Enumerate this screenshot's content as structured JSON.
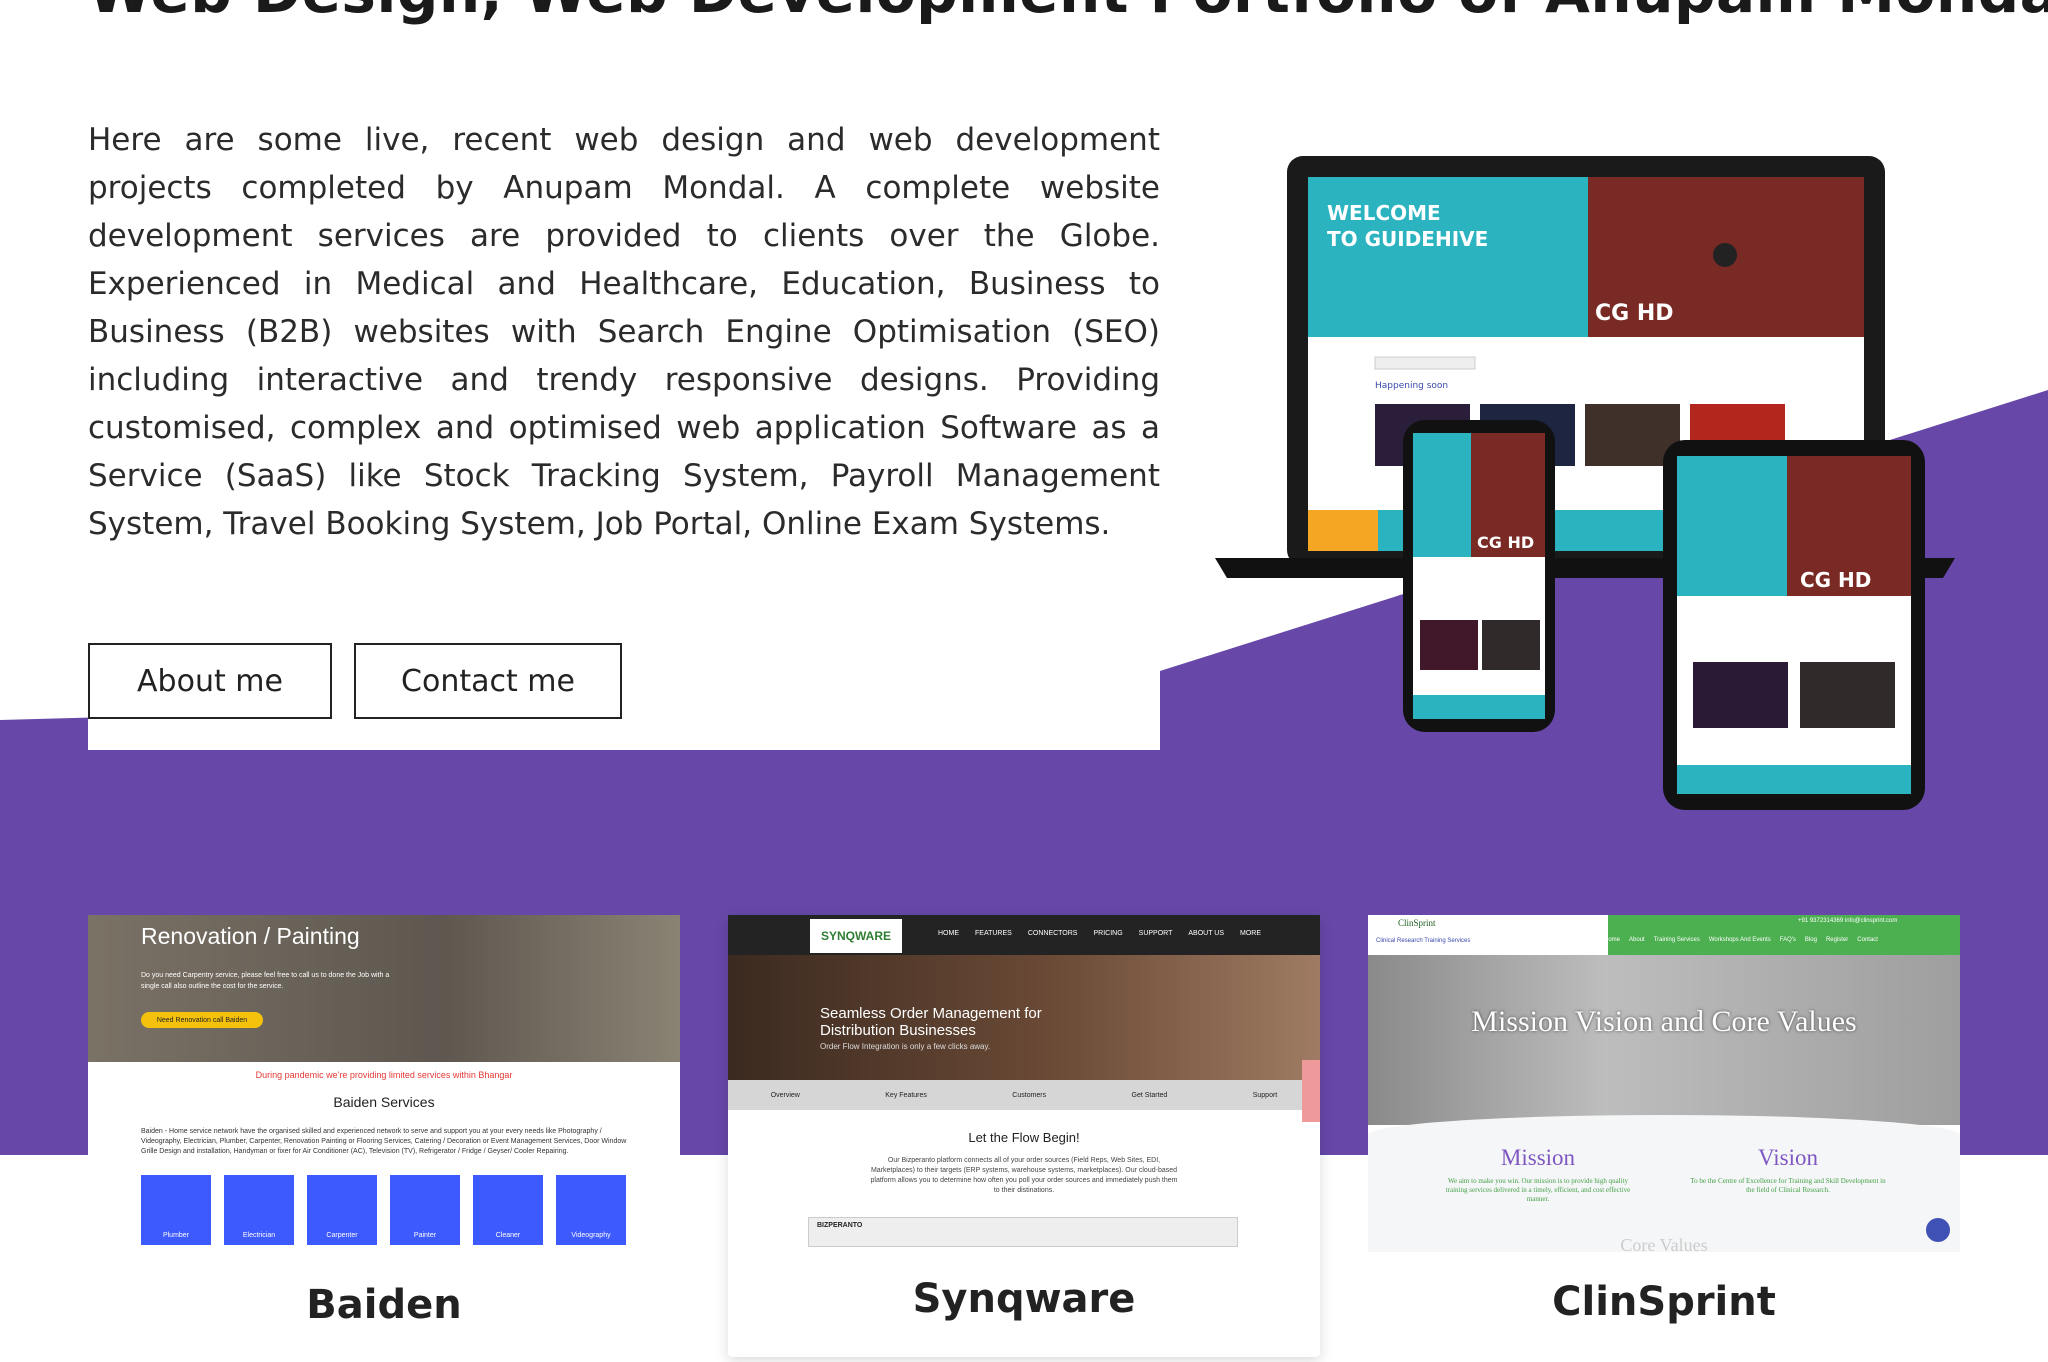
{
  "page": {
    "title": "Web Design, Web Development Portfolio of Anupam Mondal",
    "intro": "Here are some live, recent web design and web development projects completed by Anupam Mondal. A complete website development services are provided to clients over the Globe. Experienced in Medical and Healthcare, Education, Business to Business (B2B) websites with Search Engine Optimisation (SEO) including interactive and trendy responsive designs. Providing customised, complex and optimised web application Software as a Service (SaaS) like Stock Tracking System, Payroll Management System, Travel Booking System, Job Portal, Online Exam Systems."
  },
  "buttons": {
    "about": "About me",
    "contact": "Contact me"
  },
  "colors": {
    "accent": "#6748a8",
    "card_border": "#222222"
  },
  "mockup": {
    "welcome": "WELCOME\nTO GUIDEHIVE",
    "badge": "CG HD",
    "subheading": "Happening soon"
  },
  "projects": [
    {
      "name": "Baiden",
      "screenshot": {
        "hero_title": "Renovation / Painting",
        "hero_desc": "Do you need Carpentry service, please feel free to call us to done the Job with a single call also outline the cost for the service.",
        "cta": "Need Renovation call Baiden",
        "pandemic": "During pandemic we're providing limited services within Bhangar",
        "services_title": "Baiden Services",
        "about": "Baiden - Home service network have the organised skilled and experienced network to serve and support you at your every needs like Photography / Videography, Electrician, Plumber, Carpenter, Renovation Painting or Flooring Services, Catering / Decoration or Event Management Services, Door Window Grille Design and installation, Handyman or fixer for Air Conditioner (AC), Television (TV), Refrigerator / Fridge / Geyser/ Cooler Repairing.",
        "tiles": [
          "Plumber",
          "Electrician",
          "Carpenter",
          "Painter",
          "Cleaner",
          "Videography"
        ]
      }
    },
    {
      "name": "Synqware",
      "screenshot": {
        "logo": "SYNQWARE",
        "menu": [
          "HOME",
          "FEATURES",
          "CONNECTORS",
          "PRICING",
          "SUPPORT",
          "ABOUT US",
          "MORE"
        ],
        "hero_title": "Seamless Order Management for Distribution Businesses",
        "hero_sub": "Order Flow Integration is only a few clicks away.",
        "tabs": [
          "Overview",
          "Key Features",
          "Customers",
          "Get Started",
          "Support"
        ],
        "flow_title": "Let the Flow Begin!",
        "flow_text": "Our Bizperanto platform connects all of your order sources (Field Reps, Web Sites, EDI, Marketplaces) to their targets (ERP systems, warehouse systems, marketplaces). Our cloud-based platform allows you to determine how often you poll your order sources and immediately push them to their distinations.",
        "app_label": "BIZPERANTO"
      }
    },
    {
      "name": "ClinSprint",
      "screenshot": {
        "logo": "ClinSprint",
        "tagline": "Clinical Research Training Services",
        "contact": "+91 9372314369   info@clinsprint.com",
        "menu": [
          "Home",
          "About",
          "Training Services",
          "Workshops And Events",
          "FAQ's",
          "Blog",
          "Register",
          "Contact"
        ],
        "hero_title": "Mission Vision and Core Values",
        "mission_title": "Mission",
        "mission_text": "We aim to make you win. Our mission is to provide high quality training services delivered in a timely, efficient, and cost effective manner.",
        "vision_title": "Vision",
        "vision_text": "To be the Centre of Excellence for Training and Skill Development in the field of Clinical Research.",
        "core_title": "Core Values"
      }
    }
  ]
}
